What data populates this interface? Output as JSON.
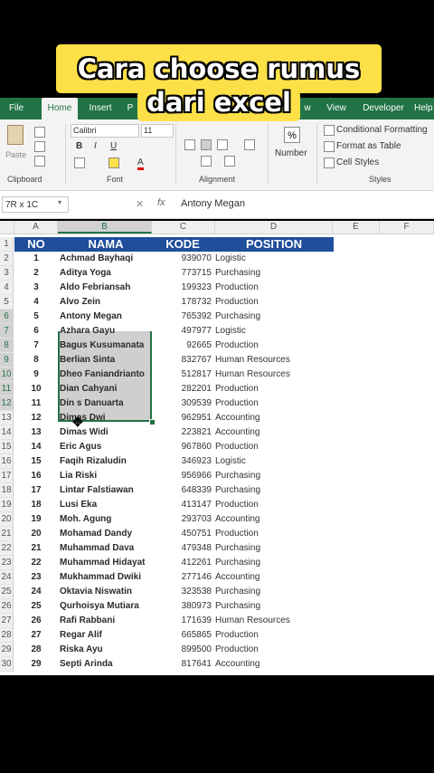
{
  "caption": {
    "line1": "Cara choose rumus",
    "line2": "dari excel"
  },
  "ribbon": {
    "tabs": [
      "File",
      "Home",
      "Insert",
      "P",
      "w",
      "View",
      "Developer",
      "Help"
    ],
    "active_tab": "Home",
    "clipboard": {
      "paste": "Paste",
      "label": "Clipboard"
    },
    "font": {
      "name": "Calibri",
      "size": "11",
      "bold": "B",
      "italic": "I",
      "underline": "U",
      "fontcolor": "A",
      "label": "Font"
    },
    "alignment": {
      "label": "Alignment"
    },
    "number": {
      "percent": "%",
      "label": "Number"
    },
    "styles": {
      "conditional": "Conditional Formatting",
      "format_table": "Format as Table",
      "cell_styles": "Cell Styles",
      "label": "Styles"
    }
  },
  "formula_bar": {
    "name_box": "7R x 1C",
    "fx": "fx",
    "value": "Antony Megan"
  },
  "columns": [
    "A",
    "B",
    "C",
    "D",
    "E",
    "F"
  ],
  "header": {
    "no": "NO",
    "nama": "NAMA",
    "kode": "KODE",
    "position": "POSITION"
  },
  "rows": [
    {
      "r": "2",
      "no": "1",
      "nama": "Achmad Bayhaqi",
      "kode": "939070",
      "pos": "Logistic"
    },
    {
      "r": "3",
      "no": "2",
      "nama": "Aditya Yoga",
      "kode": "773715",
      "pos": "Purchasing"
    },
    {
      "r": "4",
      "no": "3",
      "nama": "Aldo Febriansah",
      "kode": "199323",
      "pos": "Production"
    },
    {
      "r": "5",
      "no": "4",
      "nama": "Alvo Zein",
      "kode": "178732",
      "pos": "Production"
    },
    {
      "r": "6",
      "no": "5",
      "nama": "Antony Megan",
      "kode": "765392",
      "pos": "Purchasing"
    },
    {
      "r": "7",
      "no": "6",
      "nama": "Azhara Gayu",
      "kode": "497977",
      "pos": "Logistic"
    },
    {
      "r": "8",
      "no": "7",
      "nama": "Bagus Kusumanata",
      "kode": "92665",
      "pos": "Production"
    },
    {
      "r": "9",
      "no": "8",
      "nama": "Berlian Sinta",
      "kode": "832767",
      "pos": "Human Resources"
    },
    {
      "r": "10",
      "no": "9",
      "nama": "Dheo Faniandrianto",
      "kode": "512817",
      "pos": "Human Resources"
    },
    {
      "r": "11",
      "no": "10",
      "nama": "Dian Cahyani",
      "kode": "282201",
      "pos": "Production"
    },
    {
      "r": "12",
      "no": "11",
      "nama": "Din  s Danuarta",
      "kode": "309539",
      "pos": "Production"
    },
    {
      "r": "13",
      "no": "12",
      "nama": "Dimas Dwi",
      "kode": "962951",
      "pos": "Accounting"
    },
    {
      "r": "14",
      "no": "13",
      "nama": "Dimas Widi",
      "kode": "223821",
      "pos": "Accounting"
    },
    {
      "r": "15",
      "no": "14",
      "nama": "Eric Agus",
      "kode": "967860",
      "pos": "Production"
    },
    {
      "r": "16",
      "no": "15",
      "nama": "Faqih Rizaludin",
      "kode": "346923",
      "pos": "Logistic"
    },
    {
      "r": "17",
      "no": "16",
      "nama": "Lia Riski",
      "kode": "956966",
      "pos": "Purchasing"
    },
    {
      "r": "18",
      "no": "17",
      "nama": "Lintar Falstiawan",
      "kode": "648339",
      "pos": "Purchasing"
    },
    {
      "r": "19",
      "no": "18",
      "nama": "Lusi Eka",
      "kode": "413147",
      "pos": "Production"
    },
    {
      "r": "20",
      "no": "19",
      "nama": "Moh. Agung",
      "kode": "293703",
      "pos": "Accounting"
    },
    {
      "r": "21",
      "no": "20",
      "nama": "Mohamad Dandy",
      "kode": "450751",
      "pos": "Production"
    },
    {
      "r": "22",
      "no": "21",
      "nama": "Muhammad Dava",
      "kode": "479348",
      "pos": "Purchasing"
    },
    {
      "r": "23",
      "no": "22",
      "nama": "Muhammad Hidayat",
      "kode": "412261",
      "pos": "Purchasing"
    },
    {
      "r": "24",
      "no": "23",
      "nama": "Mukhammad Dwiki",
      "kode": "277146",
      "pos": "Accounting"
    },
    {
      "r": "25",
      "no": "24",
      "nama": "Oktavia Niswatin",
      "kode": "323538",
      "pos": "Purchasing"
    },
    {
      "r": "26",
      "no": "25",
      "nama": "Qurhoisya Mutiara",
      "kode": "380973",
      "pos": "Purchasing"
    },
    {
      "r": "27",
      "no": "26",
      "nama": "Rafi Rabbani",
      "kode": "171639",
      "pos": "Human Resources"
    },
    {
      "r": "28",
      "no": "27",
      "nama": "Regar Alif",
      "kode": "665865",
      "pos": "Production"
    },
    {
      "r": "29",
      "no": "28",
      "nama": "Riska Ayu",
      "kode": "899500",
      "pos": "Production"
    },
    {
      "r": "30",
      "no": "29",
      "nama": "Septi Arinda",
      "kode": "817641",
      "pos": "Accounting"
    }
  ],
  "colors": {
    "excel_green": "#217346",
    "header_blue": "#1f4e9b",
    "caption_yellow": "#fde047"
  }
}
